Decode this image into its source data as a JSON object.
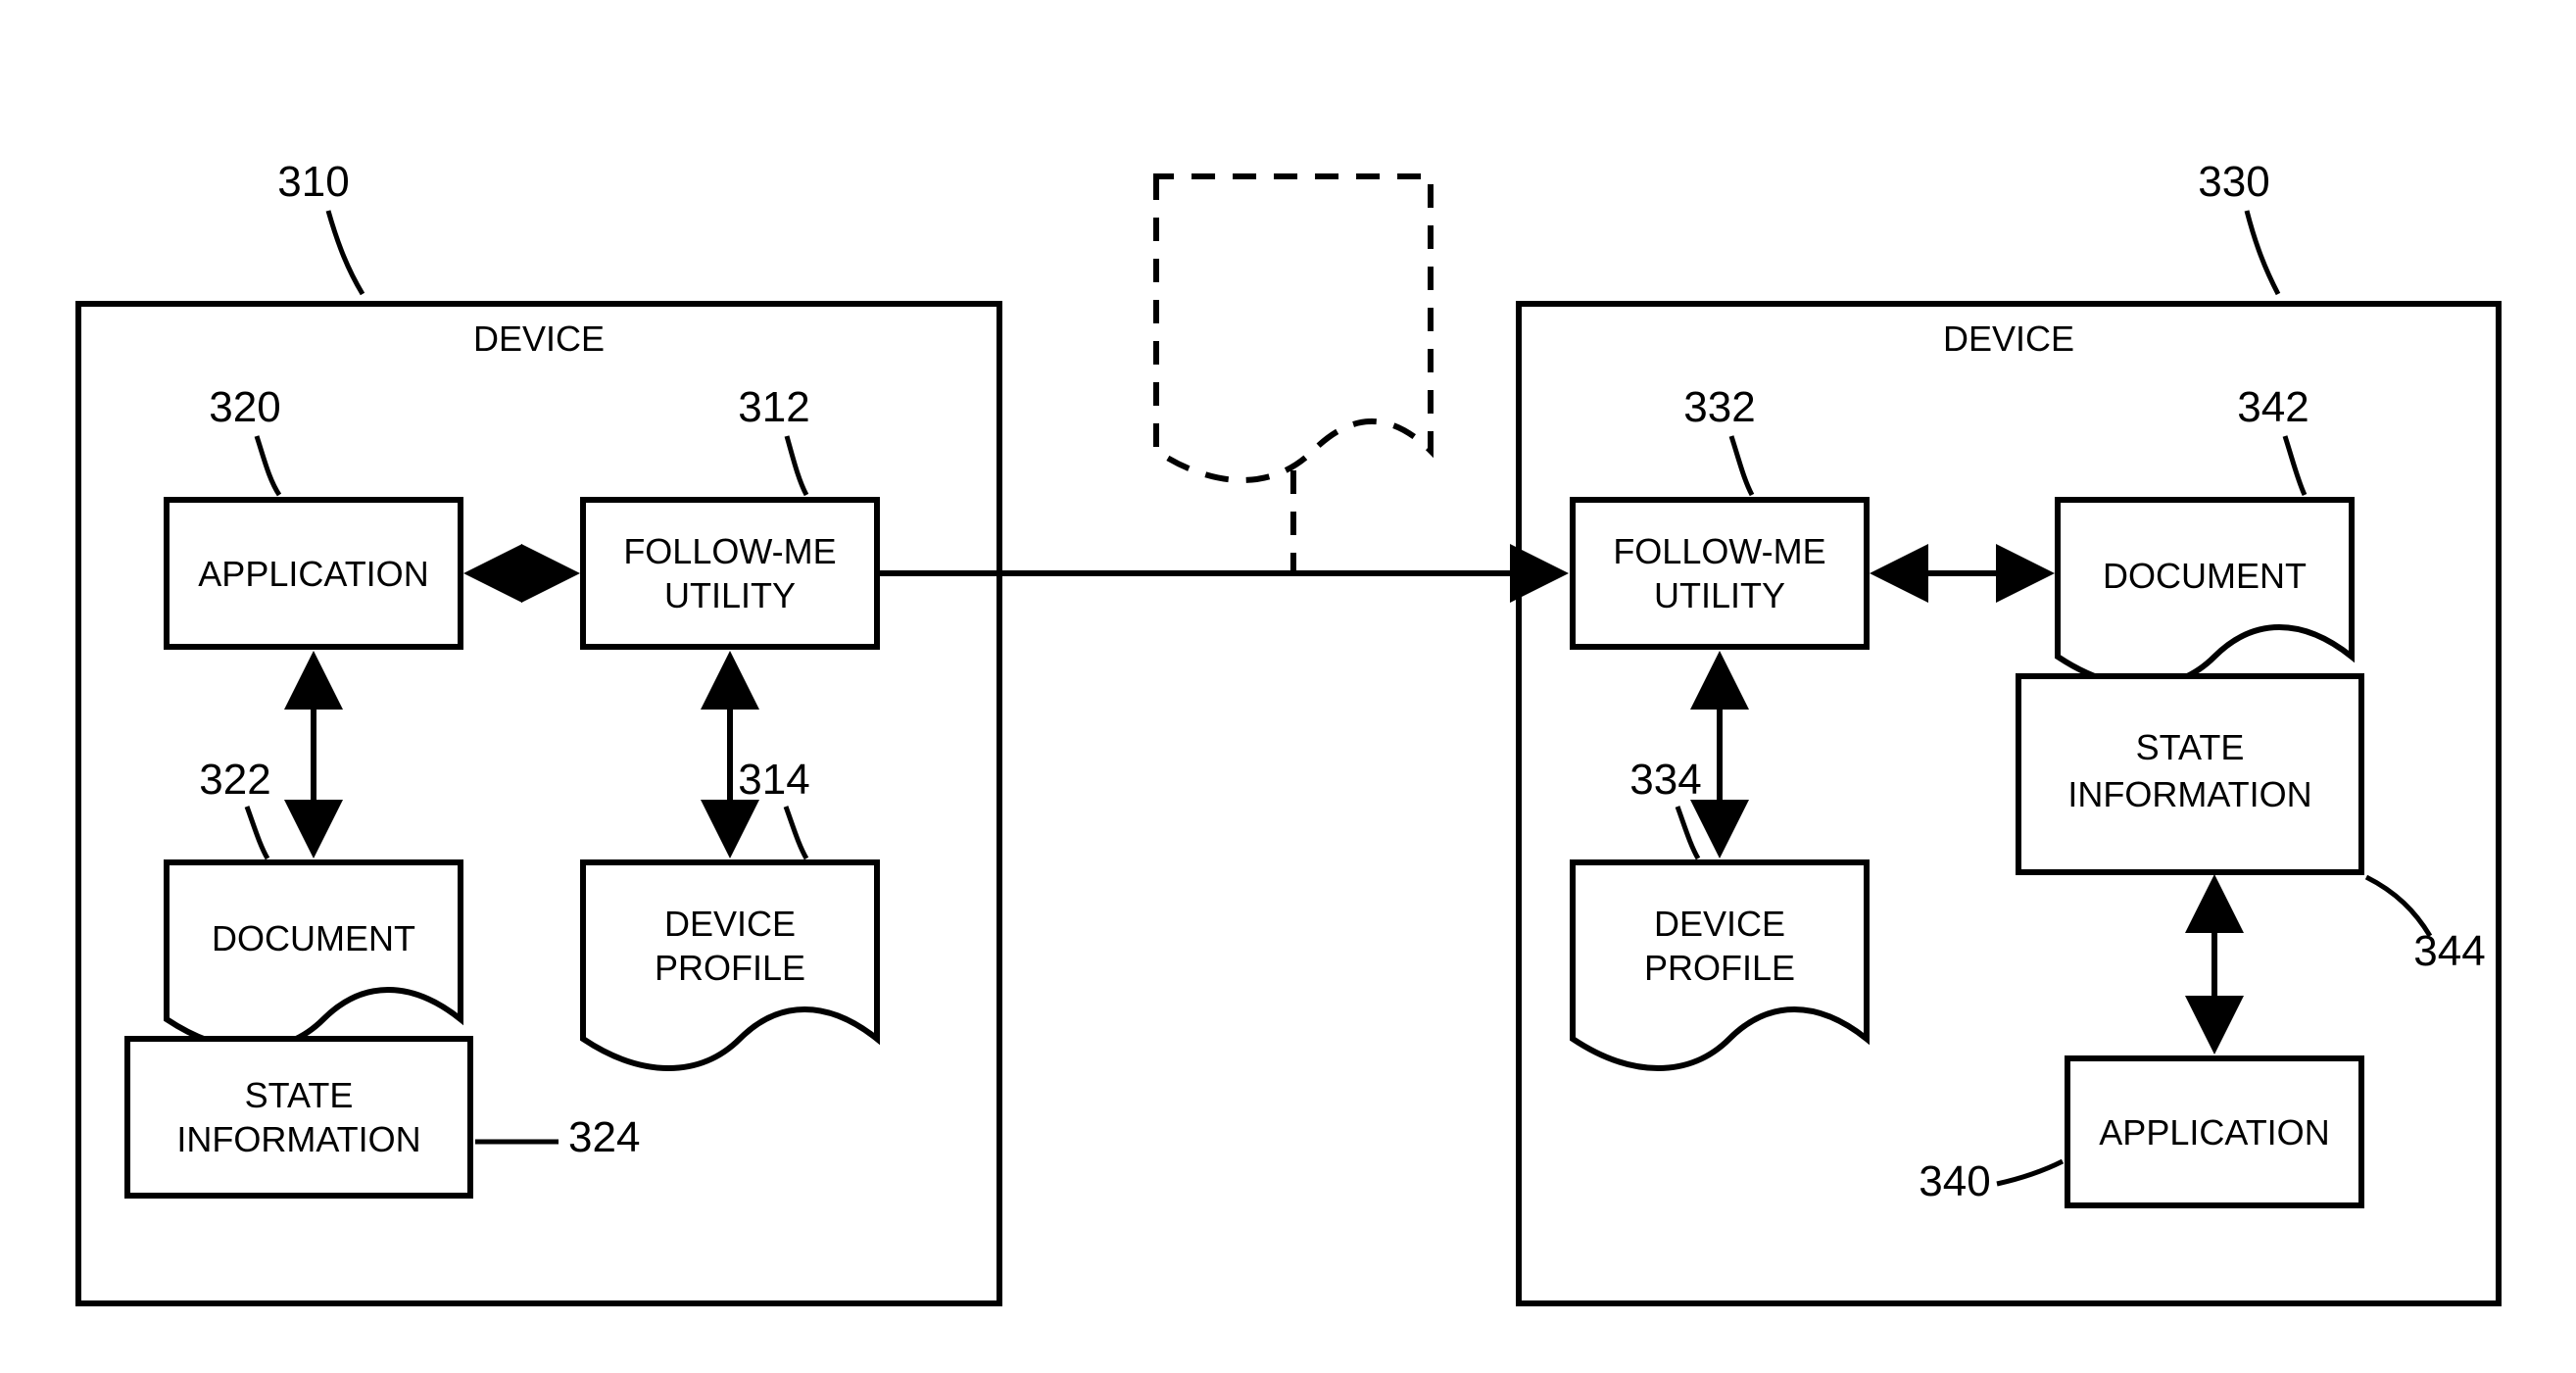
{
  "refs": {
    "device_left": "310",
    "follow_me_left": "312",
    "device_profile_left": "314",
    "application_left": "320",
    "document_left": "322",
    "state_info_left": "324",
    "device_right": "330",
    "follow_me_right": "332",
    "device_profile_right": "334",
    "application_right": "340",
    "document_right": "342",
    "state_info_right": "344"
  },
  "labels": {
    "device": "DEVICE",
    "application": "APPLICATION",
    "follow_me_1": "FOLLOW-ME",
    "follow_me_2": "UTILITY",
    "document": "DOCUMENT",
    "device_profile_1": "DEVICE",
    "device_profile_2": "PROFILE",
    "state_info_1": "STATE",
    "state_info_2": "INFORMATION"
  }
}
